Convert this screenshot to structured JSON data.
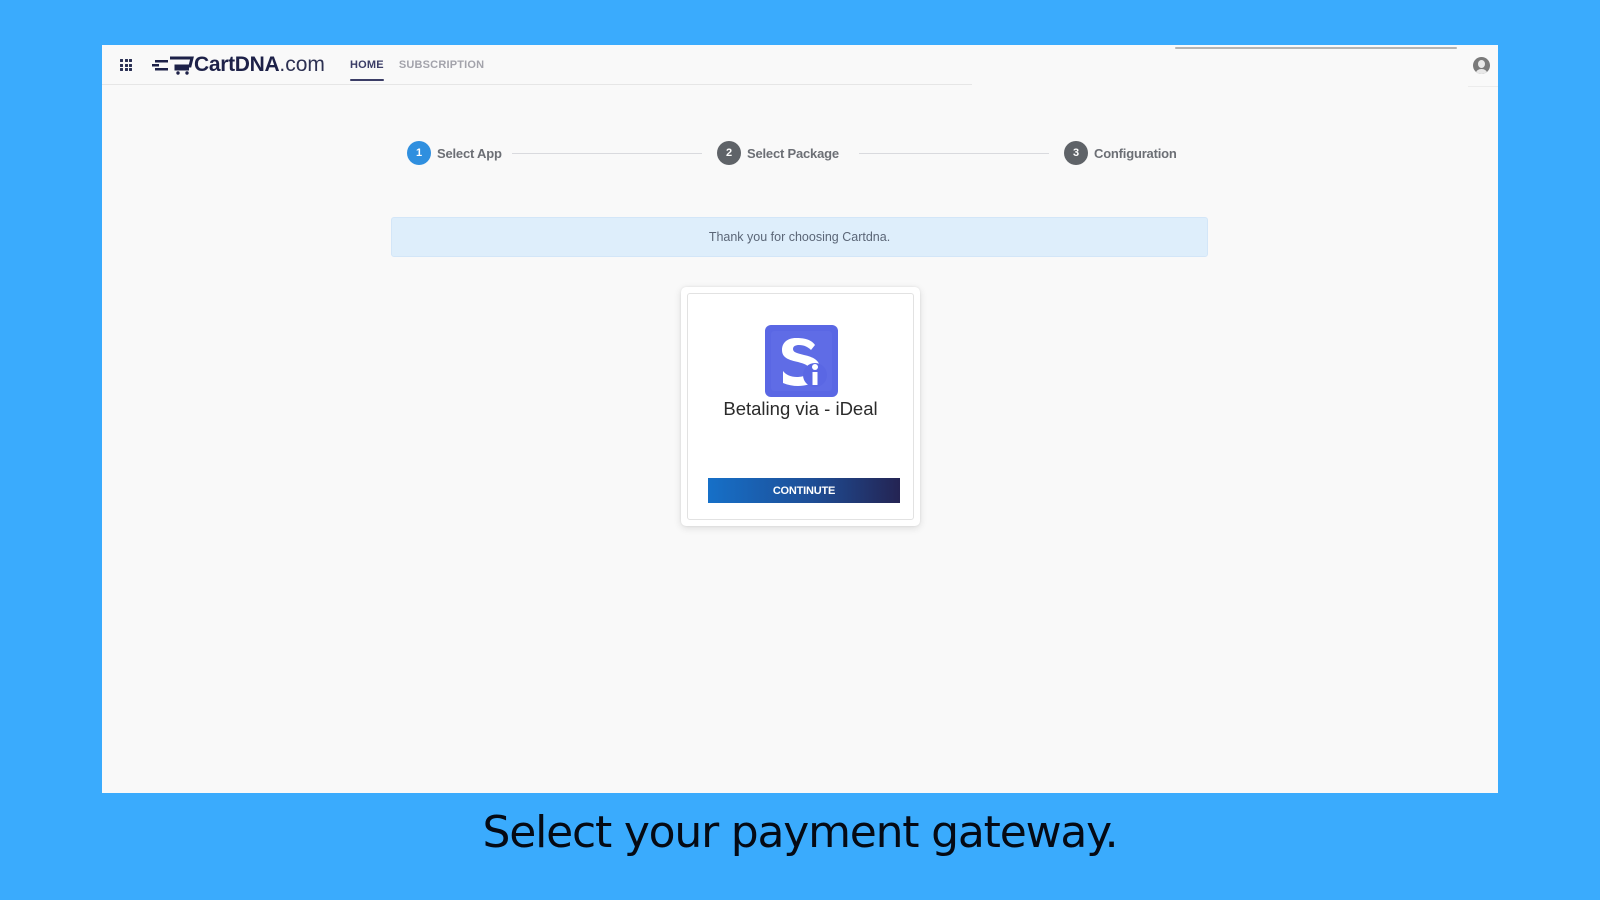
{
  "header": {
    "logo_brand": "CartDNA",
    "logo_suffix": ".com",
    "nav": [
      {
        "label": "HOME",
        "active": true
      },
      {
        "label": "SUBSCRIPTION",
        "active": false
      }
    ],
    "icons": {
      "apps": "apps-grid-icon",
      "user": "user-avatar-icon"
    }
  },
  "stepper": {
    "steps": [
      {
        "number": "1",
        "label": "Select App",
        "state": "active",
        "color": "#2f8fdf"
      },
      {
        "number": "2",
        "label": "Select Package",
        "state": "inactive",
        "color": "#5f6368"
      },
      {
        "number": "3",
        "label": "Configuration",
        "state": "inactive",
        "color": "#5f6368"
      }
    ]
  },
  "banner": {
    "message": "Thank you for choosing Cartdna."
  },
  "app_card": {
    "name": "Betaling via - iDeal",
    "icon": "ideal-app-icon",
    "icon_color": "#5a67e4",
    "button_label": "CONTINUTE"
  },
  "caption": "Select your payment gateway."
}
